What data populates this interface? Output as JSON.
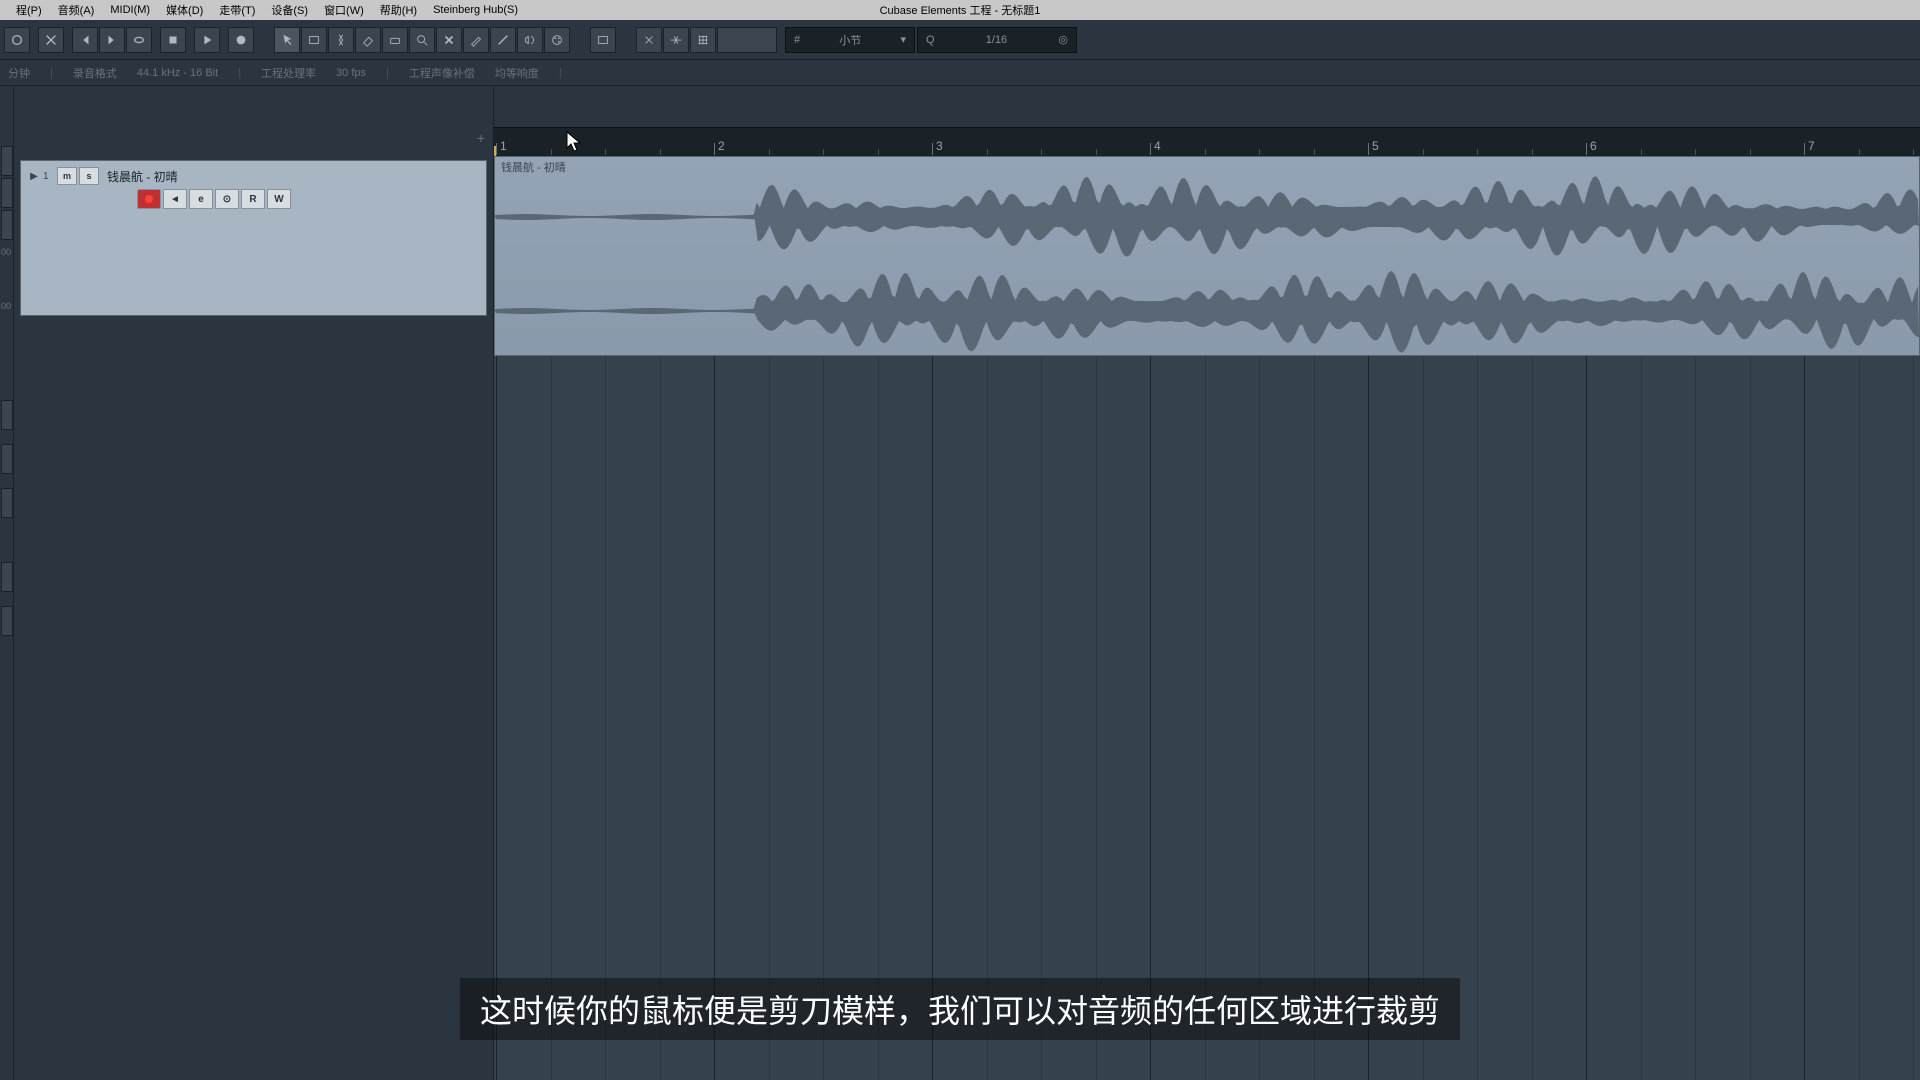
{
  "menu": {
    "items": [
      "程(P)",
      "音频(A)",
      "MIDI(M)",
      "媒体(D)",
      "走带(T)",
      "设备(S)",
      "窗口(W)",
      "帮助(H)",
      "Steinberg Hub(S)"
    ],
    "title": "Cubase Elements 工程 - 无标题1"
  },
  "toolbar": {
    "grid_label": "小节",
    "quantize_label": "1/16",
    "quantize_icon": "Q"
  },
  "status": {
    "item1": "分钟",
    "item2": "录音格式",
    "item3": "44.1 kHz - 16 Bit",
    "item4": "工程处理率",
    "item5": "30 fps",
    "item6": "工程声像补偿",
    "item7": "均等响度"
  },
  "track": {
    "num": "1",
    "m": "m",
    "s": "s",
    "name": "钱晨航 - 初晴",
    "btn_e": "e",
    "btn_r": "R",
    "btn_w": "W",
    "add": "+"
  },
  "left_rail": {
    "n1": "00",
    "n2": "00"
  },
  "ruler": {
    "bars": [
      "1",
      "2",
      "3",
      "4",
      "5",
      "6",
      "7"
    ]
  },
  "clip": {
    "label": "钱晨航 - 初晴"
  },
  "subtitle": "这时候你的鼠标便是剪刀模样，我们可以对音频的任何区域进行裁剪"
}
